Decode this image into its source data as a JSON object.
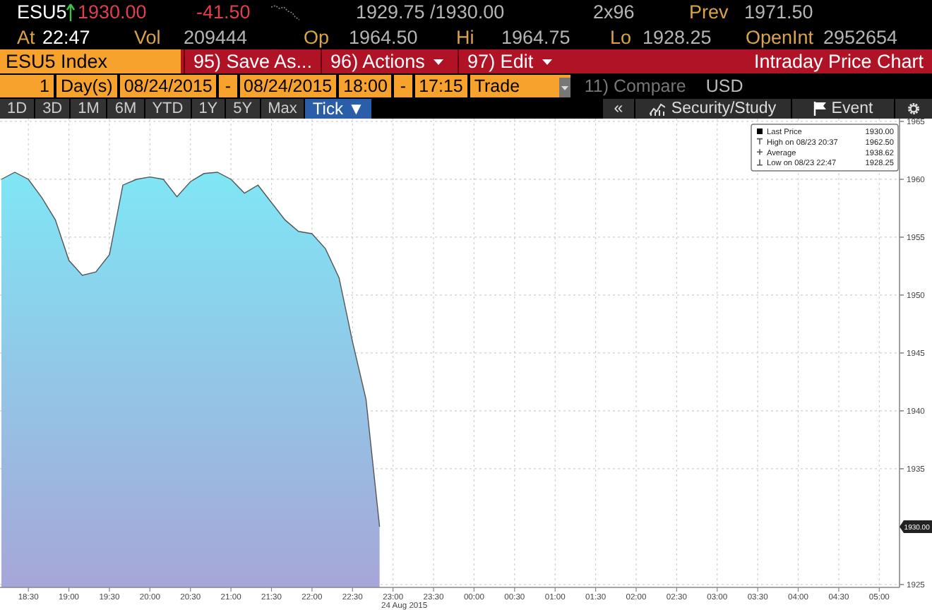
{
  "quote": {
    "ticker": "ESU5",
    "arrow_up": true,
    "last": "1930.00",
    "change": "-41.50",
    "bid_ask": "1929.75 /1930.00",
    "size": "2x96",
    "prev": {
      "label": "Prev",
      "value": "1971.50"
    },
    "time": {
      "label": "At",
      "value": "22:47"
    },
    "stats": [
      {
        "label": "Vol",
        "value": "209444"
      },
      {
        "label": "Op",
        "value": "1964.50"
      },
      {
        "label": "Hi",
        "value": "1964.75"
      },
      {
        "label": "Lo",
        "value": "1928.25"
      },
      {
        "label": "OpenInt",
        "value": "2952654"
      }
    ]
  },
  "toolbar": {
    "security": "ESU5 Index",
    "buttons": [
      {
        "label": "95) Save As...",
        "dropdown": false
      },
      {
        "label": "96) Actions",
        "dropdown": true
      },
      {
        "label": "97) Edit",
        "dropdown": true
      }
    ],
    "title": "Intraday Price Chart"
  },
  "range": [
    {
      "kind": "number",
      "text": "1"
    },
    {
      "kind": "field",
      "text": "Day(s)"
    },
    {
      "kind": "field",
      "text": "08/24/2015"
    },
    {
      "kind": "separator",
      "text": "-"
    },
    {
      "kind": "field",
      "text": "08/24/2015"
    },
    {
      "kind": "field",
      "text": "18:00"
    },
    {
      "kind": "separator",
      "text": "-"
    },
    {
      "kind": "field",
      "text": "17:15"
    },
    {
      "kind": "dropdown",
      "text": "Trade"
    }
  ],
  "compare": {
    "label": "11) Compare",
    "disabled": true
  },
  "currency": "USD",
  "periods": [
    {
      "label": "1D",
      "selected": false
    },
    {
      "label": "3D",
      "selected": false
    },
    {
      "label": "1M",
      "selected": false
    },
    {
      "label": "6M",
      "selected": false
    },
    {
      "label": "YTD",
      "selected": false
    },
    {
      "label": "1Y",
      "selected": false
    },
    {
      "label": "5Y",
      "selected": false
    },
    {
      "label": "Max",
      "selected": false
    },
    {
      "label": "Tick ▼",
      "selected": true
    }
  ],
  "tools": [
    {
      "kind": "collapse",
      "label": "«"
    },
    {
      "kind": "study",
      "label": "Security/Study"
    },
    {
      "kind": "event",
      "label": "Event"
    },
    {
      "kind": "settings"
    }
  ],
  "chart": {
    "legend": [
      {
        "kind": "last",
        "value": "1930.00"
      },
      {
        "kind": "high",
        "label": "High on 08/23 20:37",
        "value": "1962.50"
      },
      {
        "kind": "average",
        "label": "Average",
        "value": "1938.62"
      },
      {
        "kind": "low",
        "label": "Low on 08/23 22:47",
        "value": "1928.25"
      }
    ],
    "last_price_tag": "1930.00",
    "date_label": "24 Aug 2015",
    "chart_data": {
      "type": "area",
      "categories": [
        null,
        null,
        "18:30",
        null,
        null,
        "19:00",
        null,
        null,
        "19:30",
        null,
        null,
        "20:00",
        null,
        null,
        "20:30",
        null,
        null,
        "21:00",
        null,
        null,
        "21:30",
        null,
        null,
        "22:00",
        null,
        null,
        "22:30",
        null,
        null,
        "23:00",
        null,
        null,
        "23:30",
        null,
        null,
        "00:00",
        null,
        null,
        "00:30",
        null,
        null,
        "01:00",
        null,
        null,
        "01:30",
        null,
        null,
        "02:00",
        null,
        null,
        "02:30",
        null,
        null,
        "03:00",
        null,
        null,
        "03:30",
        null,
        null,
        "04:00",
        null,
        null,
        "04:30",
        null,
        null,
        "05:00",
        null
      ],
      "series": [
        {
          "name": "Last Price",
          "color": "#7fe6f5",
          "values": [
            1960.0,
            1960.6,
            1960.0,
            1958.4,
            1956.5,
            1953.0,
            1951.7,
            1952.0,
            1953.5,
            1959.5,
            1960.0,
            1960.2,
            1960.0,
            1958.5,
            1959.8,
            1960.5,
            1960.6,
            1960.0,
            1958.8,
            1959.5,
            1958.0,
            1956.5,
            1955.5,
            1955.3,
            1954.0,
            1951.5,
            1946.0,
            1941.0,
            1930.0,
            null,
            null,
            null,
            null,
            null,
            null,
            null,
            null,
            null,
            null,
            null,
            null,
            null,
            null,
            null,
            null,
            null,
            null,
            null,
            null,
            null,
            null,
            null,
            null,
            null,
            null,
            null,
            null,
            null,
            null,
            null,
            null,
            null,
            null,
            null,
            null,
            null,
            null
          ]
        }
      ],
      "ylim": [
        1924.75,
        1965.24
      ],
      "grid": true,
      "yticks": [
        1925,
        1935,
        1940,
        1945,
        1950,
        1955,
        1960,
        1965
      ]
    }
  }
}
